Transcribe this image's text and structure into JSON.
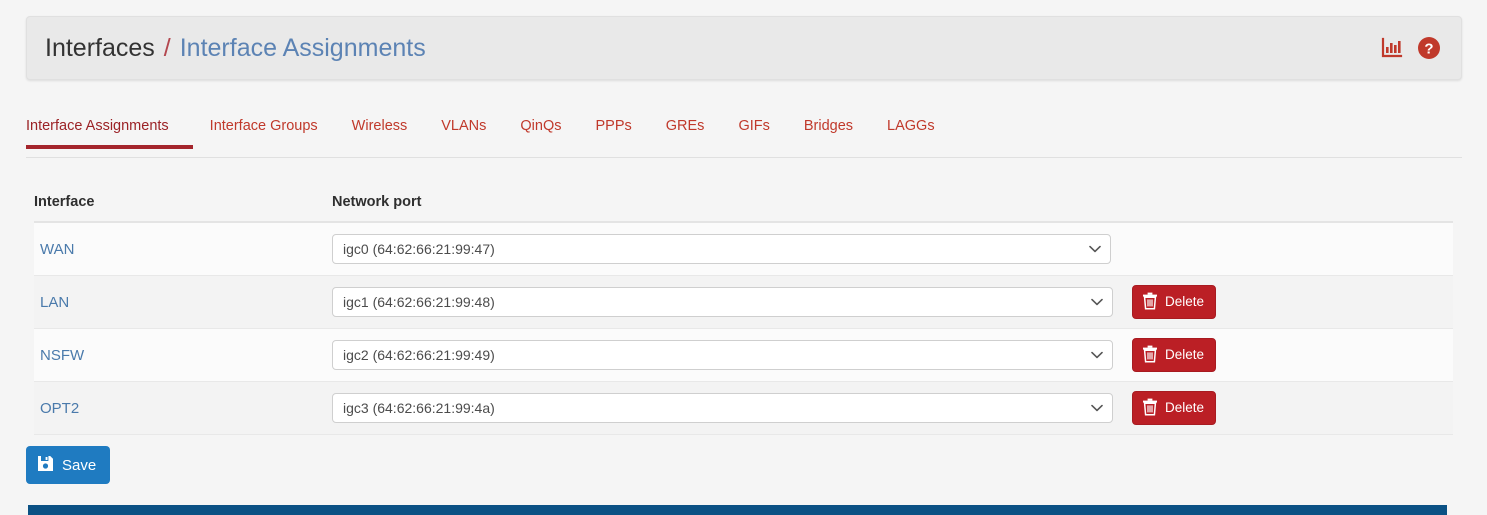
{
  "header": {
    "breadcrumb_root": "Interfaces",
    "breadcrumb_separator": "/",
    "breadcrumb_current": "Interface Assignments",
    "icons": [
      {
        "name": "stats-chart-icon",
        "color": "#c0392b"
      },
      {
        "name": "help-circle-icon",
        "color": "#c0392b"
      }
    ]
  },
  "tabs": [
    {
      "label": "Interface Assignments",
      "active": true
    },
    {
      "label": "Interface Groups",
      "active": false
    },
    {
      "label": "Wireless",
      "active": false
    },
    {
      "label": "VLANs",
      "active": false
    },
    {
      "label": "QinQs",
      "active": false
    },
    {
      "label": "PPPs",
      "active": false
    },
    {
      "label": "GREs",
      "active": false
    },
    {
      "label": "GIFs",
      "active": false
    },
    {
      "label": "Bridges",
      "active": false
    },
    {
      "label": "LAGGs",
      "active": false
    }
  ],
  "table": {
    "columns": [
      "Interface",
      "Network port",
      ""
    ],
    "rows": [
      {
        "interface": "WAN",
        "port": "igc0 (64:62:66:21:99:47)",
        "delete_label": null,
        "has_delete": false
      },
      {
        "interface": "LAN",
        "port": "igc1 (64:62:66:21:99:48)",
        "delete_label": "Delete",
        "has_delete": true
      },
      {
        "interface": "NSFW",
        "port": "igc2 (64:62:66:21:99:49)",
        "delete_label": "Delete",
        "has_delete": true
      },
      {
        "interface": "OPT2",
        "port": "igc3 (64:62:66:21:99:4a)",
        "delete_label": "Delete",
        "has_delete": true
      }
    ]
  },
  "actions": {
    "save_label": "Save"
  },
  "colors": {
    "accent_red": "#c0392b",
    "active_tab_underline": "#a4252c",
    "link_blue": "#4a7aab",
    "breadcrumb_blue": "#5c83b4",
    "delete_red": "#bb1f25",
    "save_blue": "#1f7bc1",
    "footer_blue": "#0b5184",
    "page_background": "#f5f5f5",
    "header_panel": "#e9e9e9"
  }
}
